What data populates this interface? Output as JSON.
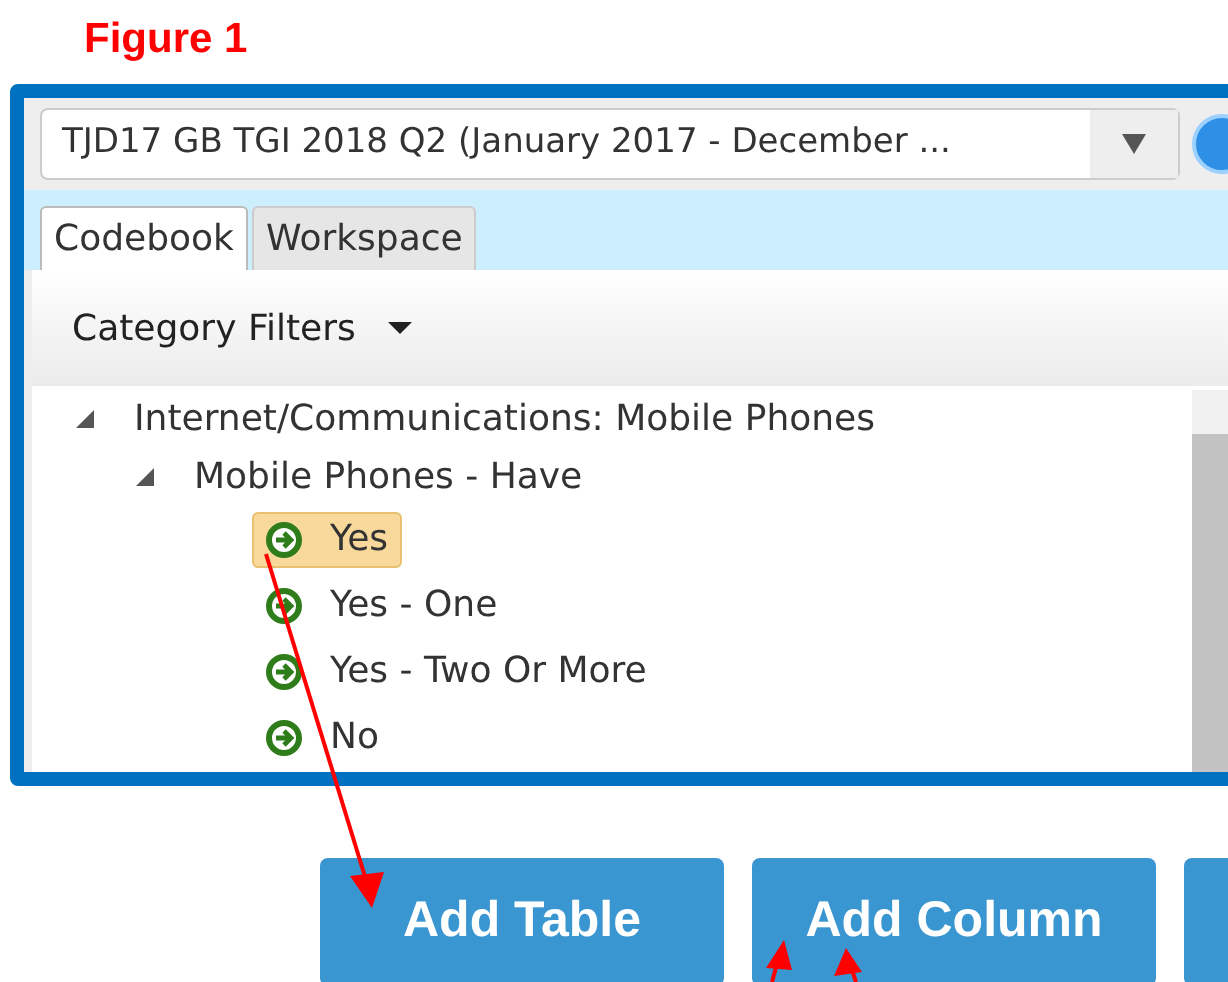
{
  "figure_label": "Figure 1",
  "dataset_select": {
    "value": "TJD17 GB TGI 2018 Q2 (January 2017 - December ..."
  },
  "tabs": [
    {
      "label": "Codebook",
      "selected": true
    },
    {
      "label": "Workspace",
      "selected": false
    }
  ],
  "filter_menu": {
    "label": "Category Filters"
  },
  "tree": [
    {
      "label": "Internet/Communications: Mobile Phones",
      "expanded": true,
      "children": [
        {
          "label": "Mobile Phones - Have",
          "expanded": true,
          "children": [
            {
              "label": "Yes",
              "selected": true
            },
            {
              "label": "Yes - One",
              "selected": false
            },
            {
              "label": "Yes - Two Or More",
              "selected": false
            },
            {
              "label": "No",
              "selected": false
            }
          ]
        }
      ]
    }
  ],
  "buttons": [
    {
      "label": "Add Table"
    },
    {
      "label": "Add Column"
    }
  ],
  "cut_off_button": true
}
